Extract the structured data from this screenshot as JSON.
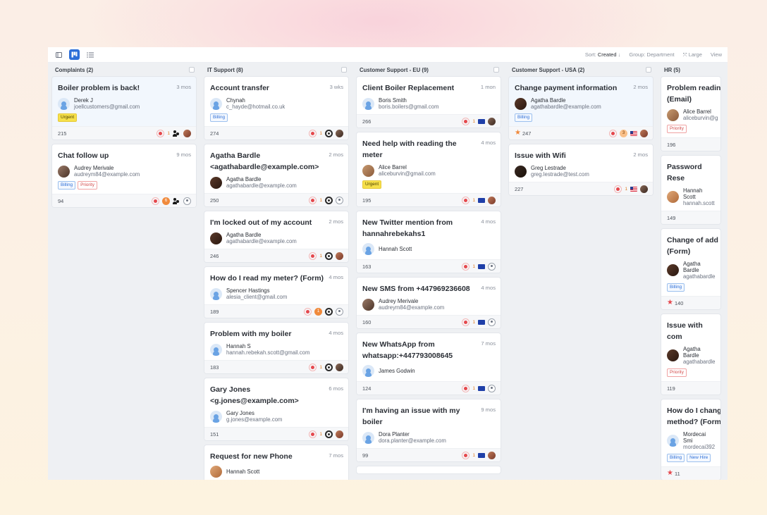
{
  "toolbar": {
    "sort_label": "Sort:",
    "sort_value": "Created",
    "sort_dir": "↓",
    "group_label": "Group:",
    "group_value": "Department",
    "size_label": "Large",
    "view_label": "View"
  },
  "columns": [
    {
      "title": "Complaints (2)",
      "cards": [
        {
          "title": "Boiler problem is back!",
          "time": "3 mos",
          "name": "Derek J",
          "email": "joellcustomers@gmail.com",
          "tags": [
            "Urgent"
          ],
          "id": "215",
          "count": "1",
          "selected": true
        },
        {
          "title": "Chat follow up",
          "time": "9 mos",
          "name": "Audrey Merivale",
          "email": "audreym84@example.com",
          "tags": [
            "Billing",
            "Priority"
          ],
          "id": "94",
          "count": "6"
        }
      ]
    },
    {
      "title": "IT Support (8)",
      "cards": [
        {
          "title": "Account transfer",
          "time": "3 wks",
          "name": "Chynah",
          "email": "c_hayde@hotmail.co.uk",
          "tags": [
            "Billing"
          ],
          "id": "274",
          "count": "1"
        },
        {
          "title": "Agatha Bardle <agathabardle@example.com>",
          "time": "2 mos",
          "name": "Agatha Bardle",
          "email": "agathabardle@example.com",
          "id": "250",
          "count": "1"
        },
        {
          "title": "I'm locked out of my account",
          "time": "2 mos",
          "name": "Agatha Bardle",
          "email": "agathabardle@example.com",
          "id": "246",
          "count": "1"
        },
        {
          "title": "How do I read my meter? (Form)",
          "time": "4 mos",
          "name": "Spencer Hastings",
          "email": "alesia_client@gmail.com",
          "id": "189",
          "count": "1"
        },
        {
          "title": "Problem with my boiler",
          "time": "4 mos",
          "name": "Hannah S",
          "email": "hannah.rebekah.scott@gmail.com",
          "id": "183",
          "count": "1"
        },
        {
          "title": "Gary Jones <g.jones@example.com>",
          "time": "6 mos",
          "name": "Gary Jones",
          "email": "g.jones@example.com",
          "id": "151",
          "count": "1"
        },
        {
          "title": "Request for new Phone",
          "time": "7 mos",
          "name": "Hannah Scott"
        }
      ]
    },
    {
      "title": "Customer Support - EU (9)",
      "cards": [
        {
          "title": "Client Boiler Replacement",
          "time": "1 mon",
          "name": "Boris Smith",
          "email": "boris.boilers@gmail.com",
          "id": "266",
          "count": "1"
        },
        {
          "title": "Need help with reading the meter",
          "time": "4 mos",
          "name": "Alice Barrel",
          "email": "aliceburvin@gmail.com",
          "tags": [
            "Urgent"
          ],
          "id": "195",
          "count": "1"
        },
        {
          "title": "New Twitter mention from hannahrebekahs1",
          "time": "4 mos",
          "name": "Hannah Scott",
          "id": "163",
          "count": "1"
        },
        {
          "title": "New SMS from +447969236608",
          "time": "4 mos",
          "name": "Audrey Merivale",
          "email": "audreym84@example.com",
          "id": "160",
          "count": "1"
        },
        {
          "title": "New WhatsApp from whatsapp:+447793008645",
          "time": "7 mos",
          "name": "James Godwin",
          "id": "124",
          "count": "1"
        },
        {
          "title": "I'm having an issue with my boiler",
          "time": "9 mos",
          "name": "Dora Planter",
          "email": "dora.planter@example.com",
          "id": "99",
          "count": "1"
        }
      ]
    },
    {
      "title": "Customer Support - USA (2)",
      "cards": [
        {
          "title": "Change payment information",
          "time": "2 mos",
          "name": "Agatha Bardle",
          "email": "agathabardle@example.com",
          "tags": [
            "Billing"
          ],
          "id": "247",
          "count": "3",
          "selected": true
        },
        {
          "title": "Issue with Wifi",
          "time": "2 mos",
          "name": "Greg Lestrade",
          "email": "greg.lestrade@test.com",
          "id": "227",
          "count": "1"
        }
      ]
    },
    {
      "title": "HR (5)",
      "cards": [
        {
          "title": "Problem readin (Email)",
          "name": "Alice Barrel",
          "email": "aliceburvin@g",
          "tags": [
            "Priority"
          ],
          "id": "196"
        },
        {
          "title": "Password Rese",
          "name": "Hannah Scott",
          "email": "hannah.scott",
          "id": "149"
        },
        {
          "title": "Change of add (Form)",
          "name": "Agatha Bardle",
          "email": "agathabardle",
          "tags": [
            "Billing"
          ],
          "id": "140"
        },
        {
          "title": "Issue with com",
          "name": "Agatha Bardle",
          "email": "agathabardle",
          "tags": [
            "Priority"
          ],
          "id": "119"
        },
        {
          "title": "How do I chang method? (Form",
          "name": "Mordecai Smi",
          "email": "mordecai392",
          "tags": [
            "Billing",
            "New Hire"
          ],
          "id": "11"
        }
      ]
    }
  ]
}
